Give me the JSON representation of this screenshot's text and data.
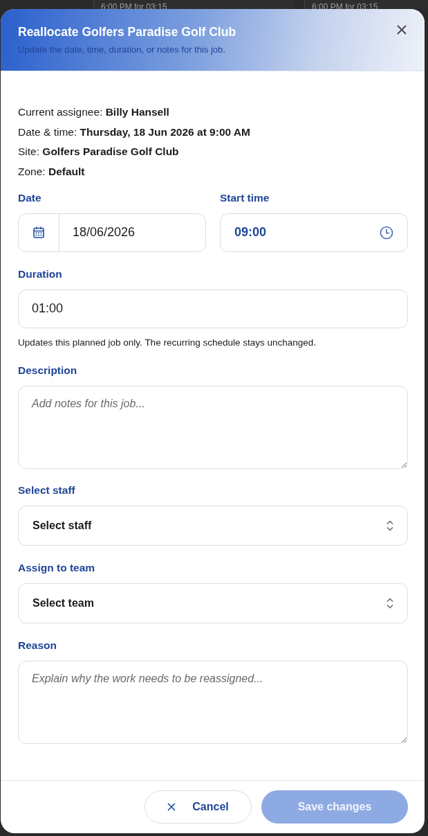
{
  "background": {
    "entries": [
      "6:00 PM for 03:15",
      "6:00 PM for 03:15"
    ]
  },
  "dialog": {
    "title": "Reallocate Golfers Paradise Golf Club",
    "subtitle": "Update the date, time, duration, or notes for this job."
  },
  "details": [
    {
      "label": "Current assignee:",
      "value": "Billy Hansell"
    },
    {
      "label": "Date & time:",
      "value": "Thursday, 18 Jun 2026 at 9:00 AM"
    },
    {
      "label": "Site:",
      "value": "Golfers Paradise Golf Club"
    },
    {
      "label": "Zone:",
      "value": "Default"
    }
  ],
  "date": {
    "label": "Date",
    "value": "18/06/2026"
  },
  "start_time": {
    "label": "Start time",
    "value": "09:00"
  },
  "duration": {
    "label": "Duration",
    "value": "01:00",
    "hint": "Updates this planned job only. The recurring schedule stays unchanged."
  },
  "description": {
    "label": "Description",
    "placeholder": "Add notes for this job..."
  },
  "select_staff": {
    "label": "Select staff",
    "value": "Select staff"
  },
  "assign_team": {
    "label": "Assign to team",
    "value": "Select team"
  },
  "reason": {
    "label": "Reason",
    "placeholder": "Explain why the work needs to be reassigned..."
  },
  "buttons": {
    "cancel": {
      "label": "Cancel"
    },
    "save": {
      "label": "Save changes",
      "disabled": true
    }
  }
}
